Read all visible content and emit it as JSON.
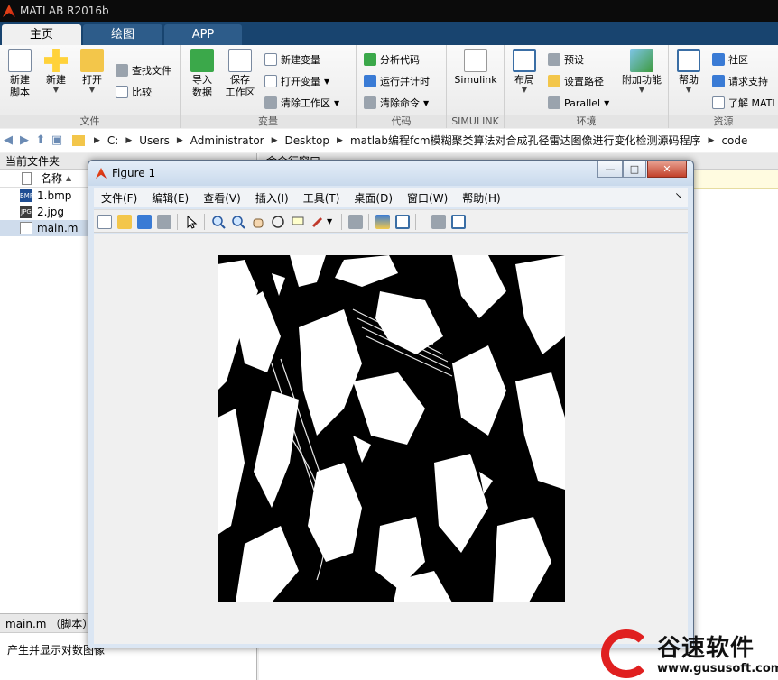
{
  "window": {
    "title": "MATLAB R2016b"
  },
  "tabs": [
    {
      "label": "主页"
    },
    {
      "label": "绘图"
    },
    {
      "label": "APP"
    }
  ],
  "ribbon": {
    "groups": {
      "file": "文件",
      "variable": "变量",
      "code": "代码",
      "simulink": "SIMULINK",
      "env": "环境",
      "resources": "资源"
    },
    "file": {
      "new_script": [
        "新建",
        "脚本"
      ],
      "new": "新建",
      "open": "打开",
      "find_files": "查找文件",
      "compare": "比较"
    },
    "variable": {
      "import": [
        "导入",
        "数据"
      ],
      "save": [
        "保存",
        "工作区"
      ],
      "new_var": "新建变量",
      "open_var": "打开变量",
      "clear_ws": "清除工作区"
    },
    "code": {
      "analyze": "分析代码",
      "run_time": "运行并计时",
      "clear_cmd": "清除命令"
    },
    "simulink": {
      "label": "Simulink"
    },
    "env": {
      "layout": "布局",
      "prefs": "预设",
      "set_path": "设置路径",
      "parallel": "Parallel",
      "addons": "附加功能"
    },
    "resources": {
      "help": "帮助",
      "community": "社区",
      "support": "请求支持",
      "learn": "了解 MATL"
    }
  },
  "address": {
    "crumbs": [
      "C:",
      "Users",
      "Administrator",
      "Desktop",
      "matlab编程fcm模糊聚类算法对合成孔径雷达图像进行变化检测源码程序",
      "code"
    ]
  },
  "current_folder": {
    "title": "当前文件夹",
    "column_name": "名称",
    "column_sort": "▲",
    "files": [
      {
        "name": "1.bmp",
        "icon": "BMP"
      },
      {
        "name": "2.jpg",
        "icon": "JPG"
      },
      {
        "name": "main.m",
        "icon": ""
      }
    ],
    "details_title": "main.m （脚本）",
    "details_text": "产生并显示对数图像"
  },
  "command_window": {
    "title": "命令行窗口"
  },
  "figure": {
    "title": "Figure 1",
    "window_buttons": {
      "min": "—",
      "max": "□",
      "close": "✕"
    },
    "menus": [
      "文件(F)",
      "编辑(E)",
      "查看(V)",
      "插入(I)",
      "工具(T)",
      "桌面(D)",
      "窗口(W)",
      "帮助(H)"
    ],
    "menu_arrow": "↘"
  },
  "watermark": {
    "title": "谷速软件",
    "url": "www.gususoft.com",
    "brand_color": "#e02020"
  }
}
